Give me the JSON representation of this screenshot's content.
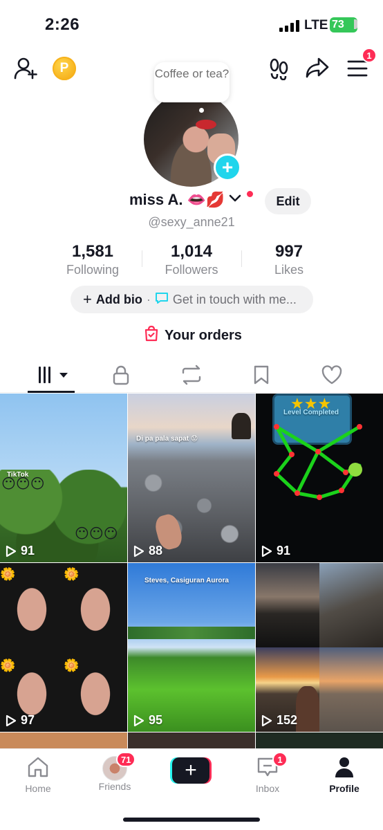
{
  "status_bar": {
    "time": "2:26",
    "network": "LTE",
    "battery": "73"
  },
  "top_bar": {
    "coin_label": "P",
    "menu_badge": "1"
  },
  "profile": {
    "note": "Coffee or tea?",
    "display_name": "miss A.",
    "name_emojis": "👄💋",
    "edit_label": "Edit",
    "username": "@sexy_anne21"
  },
  "stats": [
    {
      "value": "1,581",
      "label": "Following"
    },
    {
      "value": "1,014",
      "label": "Followers"
    },
    {
      "value": "997",
      "label": "Likes"
    }
  ],
  "bio": {
    "add_label": "Add bio",
    "separator": "·",
    "contact_label": "Get in touch with me..."
  },
  "orders": {
    "label": "Your orders"
  },
  "tabs": [
    "videos",
    "private",
    "reposts",
    "favorites",
    "liked"
  ],
  "videos": [
    {
      "views": "91",
      "caption": "TikTok"
    },
    {
      "views": "88",
      "caption": "Di pa pala sapat 😟"
    },
    {
      "views": "91",
      "caption": "Level Completed"
    },
    {
      "views": "97",
      "caption": ""
    },
    {
      "views": "95",
      "caption": "Steves, Casiguran Aurora"
    },
    {
      "views": "152",
      "caption": ""
    }
  ],
  "bottom_nav": {
    "home": "Home",
    "friends": "Friends",
    "friends_badge": "71",
    "inbox": "Inbox",
    "inbox_badge": "1",
    "profile": "Profile",
    "create": "+"
  },
  "colors": {
    "accent": "#fe2c55",
    "cyan": "#25f4ee",
    "battery": "#35c759"
  }
}
